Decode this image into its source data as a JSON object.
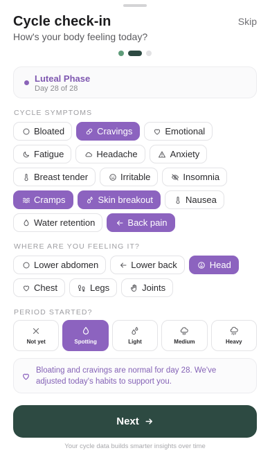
{
  "header": {
    "title": "Cycle check-in",
    "subtitle": "How's your body feeling today?",
    "skip_label": "Skip"
  },
  "progress": {
    "current_step": 2,
    "total_steps": 3
  },
  "phase": {
    "name": "Luteal Phase",
    "day_text": "Day 28 of 28",
    "accent": "#8a63b8"
  },
  "symptoms": {
    "heading": "CYCLE SYMPTOMS",
    "items": [
      {
        "label": "Bloated",
        "icon": "circle-icon",
        "selected": false
      },
      {
        "label": "Cravings",
        "icon": "pill-icon",
        "selected": true
      },
      {
        "label": "Emotional",
        "icon": "heart-icon",
        "selected": false
      },
      {
        "label": "Fatigue",
        "icon": "moon-icon",
        "selected": false
      },
      {
        "label": "Headache",
        "icon": "cloud-icon",
        "selected": false
      },
      {
        "label": "Anxiety",
        "icon": "warning-icon",
        "selected": false
      },
      {
        "label": "Breast tender",
        "icon": "thermometer-icon",
        "selected": false
      },
      {
        "label": "Irritable",
        "icon": "face-icon",
        "selected": false
      },
      {
        "label": "Insomnia",
        "icon": "eye-off-icon",
        "selected": false
      },
      {
        "label": "Cramps",
        "icon": "waves-icon",
        "selected": true
      },
      {
        "label": "Skin breakout",
        "icon": "drops-icon",
        "selected": true
      },
      {
        "label": "Nausea",
        "icon": "thermometer-icon",
        "selected": false
      },
      {
        "label": "Water retention",
        "icon": "drop-icon",
        "selected": false
      },
      {
        "label": "Back pain",
        "icon": "arrow-left-icon",
        "selected": true
      }
    ]
  },
  "location": {
    "heading": "WHERE ARE YOU FEELING IT?",
    "items": [
      {
        "label": "Lower abdomen",
        "icon": "circle-icon",
        "selected": false
      },
      {
        "label": "Lower back",
        "icon": "arrow-left-icon",
        "selected": false
      },
      {
        "label": "Head",
        "icon": "head-icon",
        "selected": true
      },
      {
        "label": "Chest",
        "icon": "heart-icon",
        "selected": false
      },
      {
        "label": "Legs",
        "icon": "footprints-icon",
        "selected": false
      },
      {
        "label": "Joints",
        "icon": "hand-icon",
        "selected": false
      }
    ]
  },
  "period": {
    "heading": "PERIOD STARTED?",
    "options": [
      {
        "label": "Not yet",
        "icon": "x-icon",
        "selected": false
      },
      {
        "label": "Spotting",
        "icon": "drop-icon",
        "selected": true
      },
      {
        "label": "Light",
        "icon": "drops-icon",
        "selected": false
      },
      {
        "label": "Medium",
        "icon": "rain-cloud-icon",
        "selected": false
      },
      {
        "label": "Heavy",
        "icon": "storm-cloud-icon",
        "selected": false
      }
    ]
  },
  "note": {
    "text": "Bloating and cravings are normal for day 28. We've adjusted today's habits to support you.",
    "icon": "heart-icon"
  },
  "cta": {
    "label": "Next",
    "icon": "arrow-right-icon"
  },
  "footer": {
    "text": "Your cycle data builds smarter insights over time"
  },
  "colors": {
    "accent": "#8c63bf",
    "primary": "#2d4a42",
    "progress_done": "#5f9c7a"
  }
}
